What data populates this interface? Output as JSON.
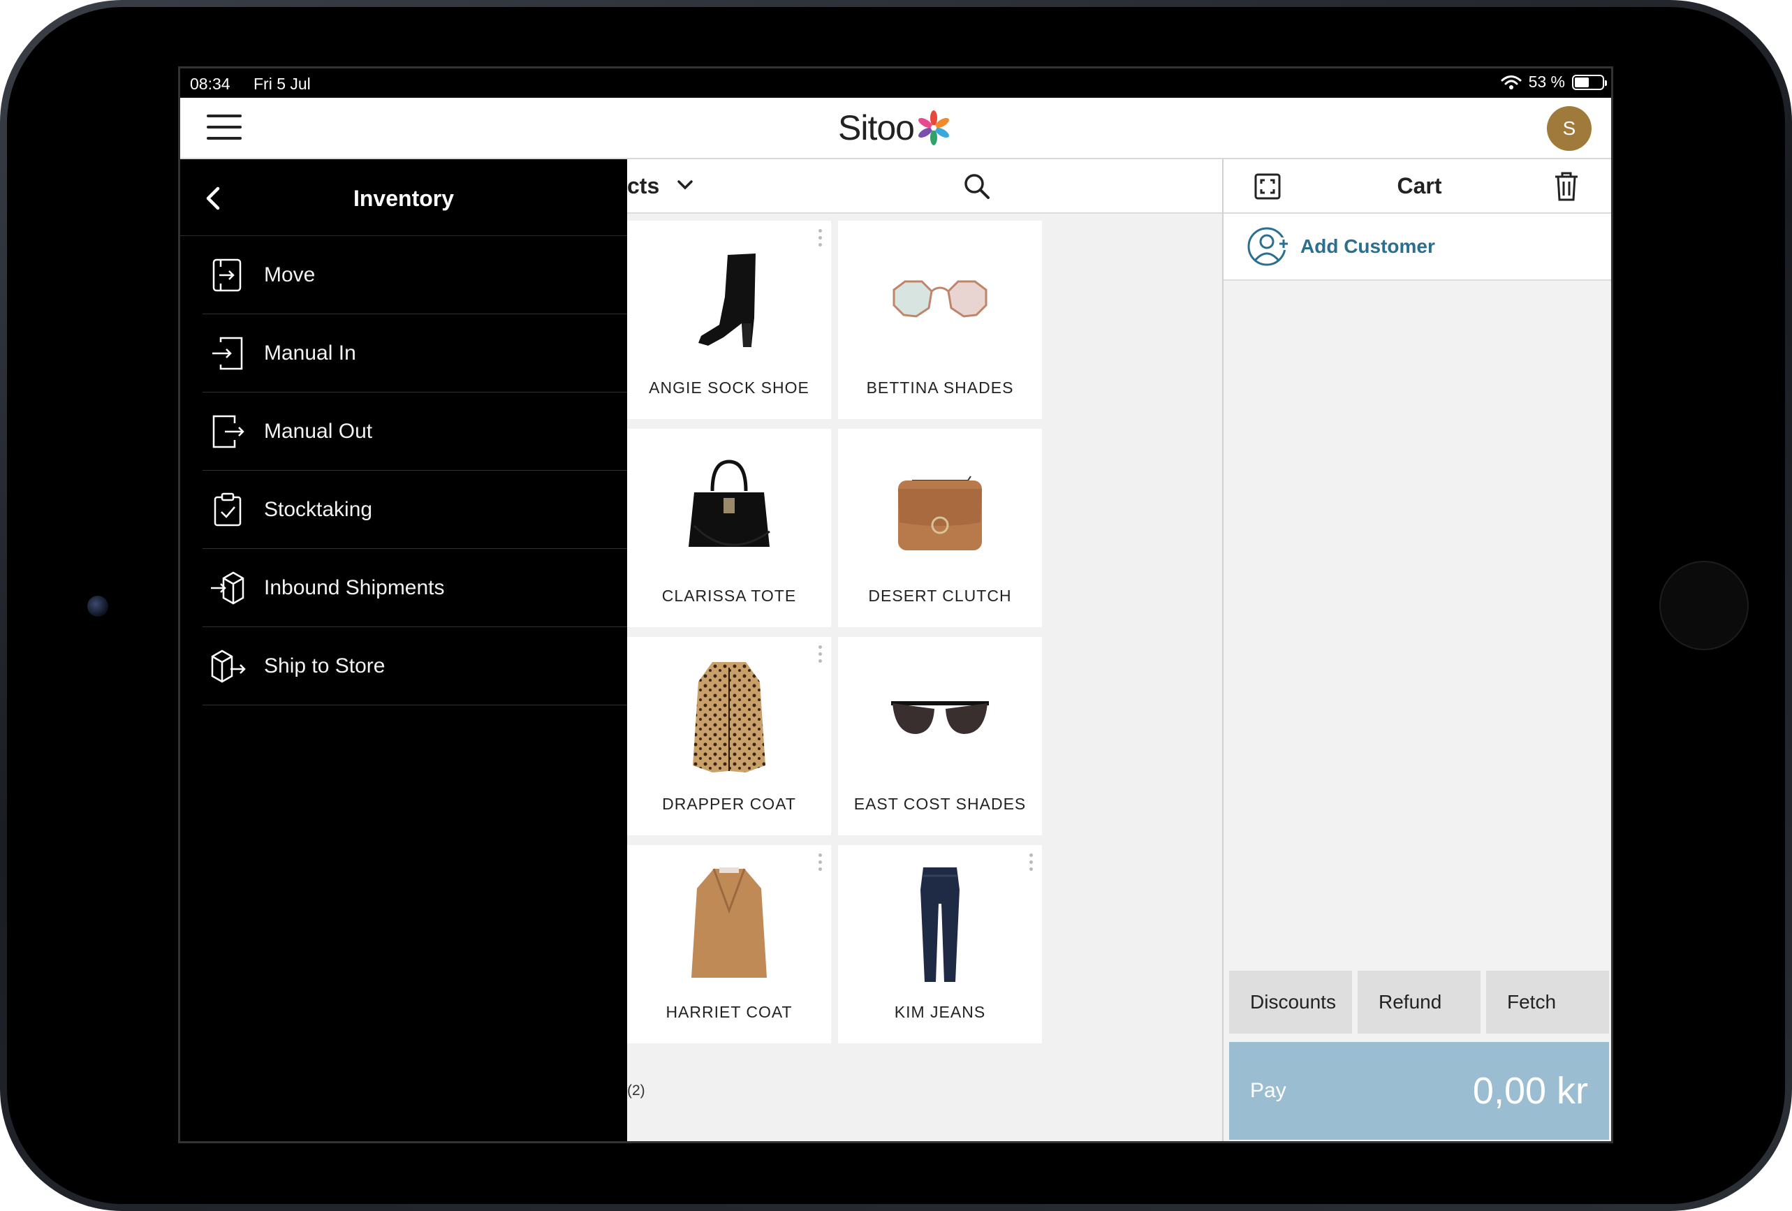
{
  "status_bar": {
    "time": "08:34",
    "date": "Fri 5 Jul",
    "battery_text": "53 %",
    "battery_level": 0.53
  },
  "app": {
    "logo_text": "Sitoo",
    "avatar_initial": "S"
  },
  "side_menu": {
    "title": "Inventory",
    "items": [
      {
        "label": "Move",
        "icon": "move-icon"
      },
      {
        "label": "Manual In",
        "icon": "manual-in-icon"
      },
      {
        "label": "Manual Out",
        "icon": "manual-out-icon"
      },
      {
        "label": "Stocktaking",
        "icon": "stocktaking-icon"
      },
      {
        "label": "Inbound Shipments",
        "icon": "inbound-shipments-icon"
      },
      {
        "label": "Ship to Store",
        "icon": "ship-to-store-icon"
      }
    ]
  },
  "products": {
    "title": "cts",
    "page_count": "(2)",
    "items": [
      {
        "name": "ANGIE SOCK SHOE",
        "icon": "boot-icon"
      },
      {
        "name": "BETTINA SHADES",
        "icon": "sunglasses-icon"
      },
      {
        "name": "CLARISSA TOTE",
        "icon": "handbag-icon"
      },
      {
        "name": "DESERT CLUTCH",
        "icon": "clutch-icon"
      },
      {
        "name": "DRAPPER COAT",
        "icon": "leopard-coat-icon"
      },
      {
        "name": "EAST COST SHADES",
        "icon": "sunglasses-icon"
      },
      {
        "name": "HARRIET COAT",
        "icon": "coat-icon"
      },
      {
        "name": "KIM JEANS",
        "icon": "jeans-icon"
      }
    ]
  },
  "cart": {
    "title": "Cart",
    "add_customer_label": "Add Customer",
    "actions": [
      "Discounts",
      "Refund",
      "Fetch"
    ],
    "pay_label": "Pay",
    "pay_amount": "0,00 kr"
  },
  "colors": {
    "accent": "#2a6f8f",
    "pay_button": "#9bbdd2",
    "avatar": "#a07a3a"
  }
}
